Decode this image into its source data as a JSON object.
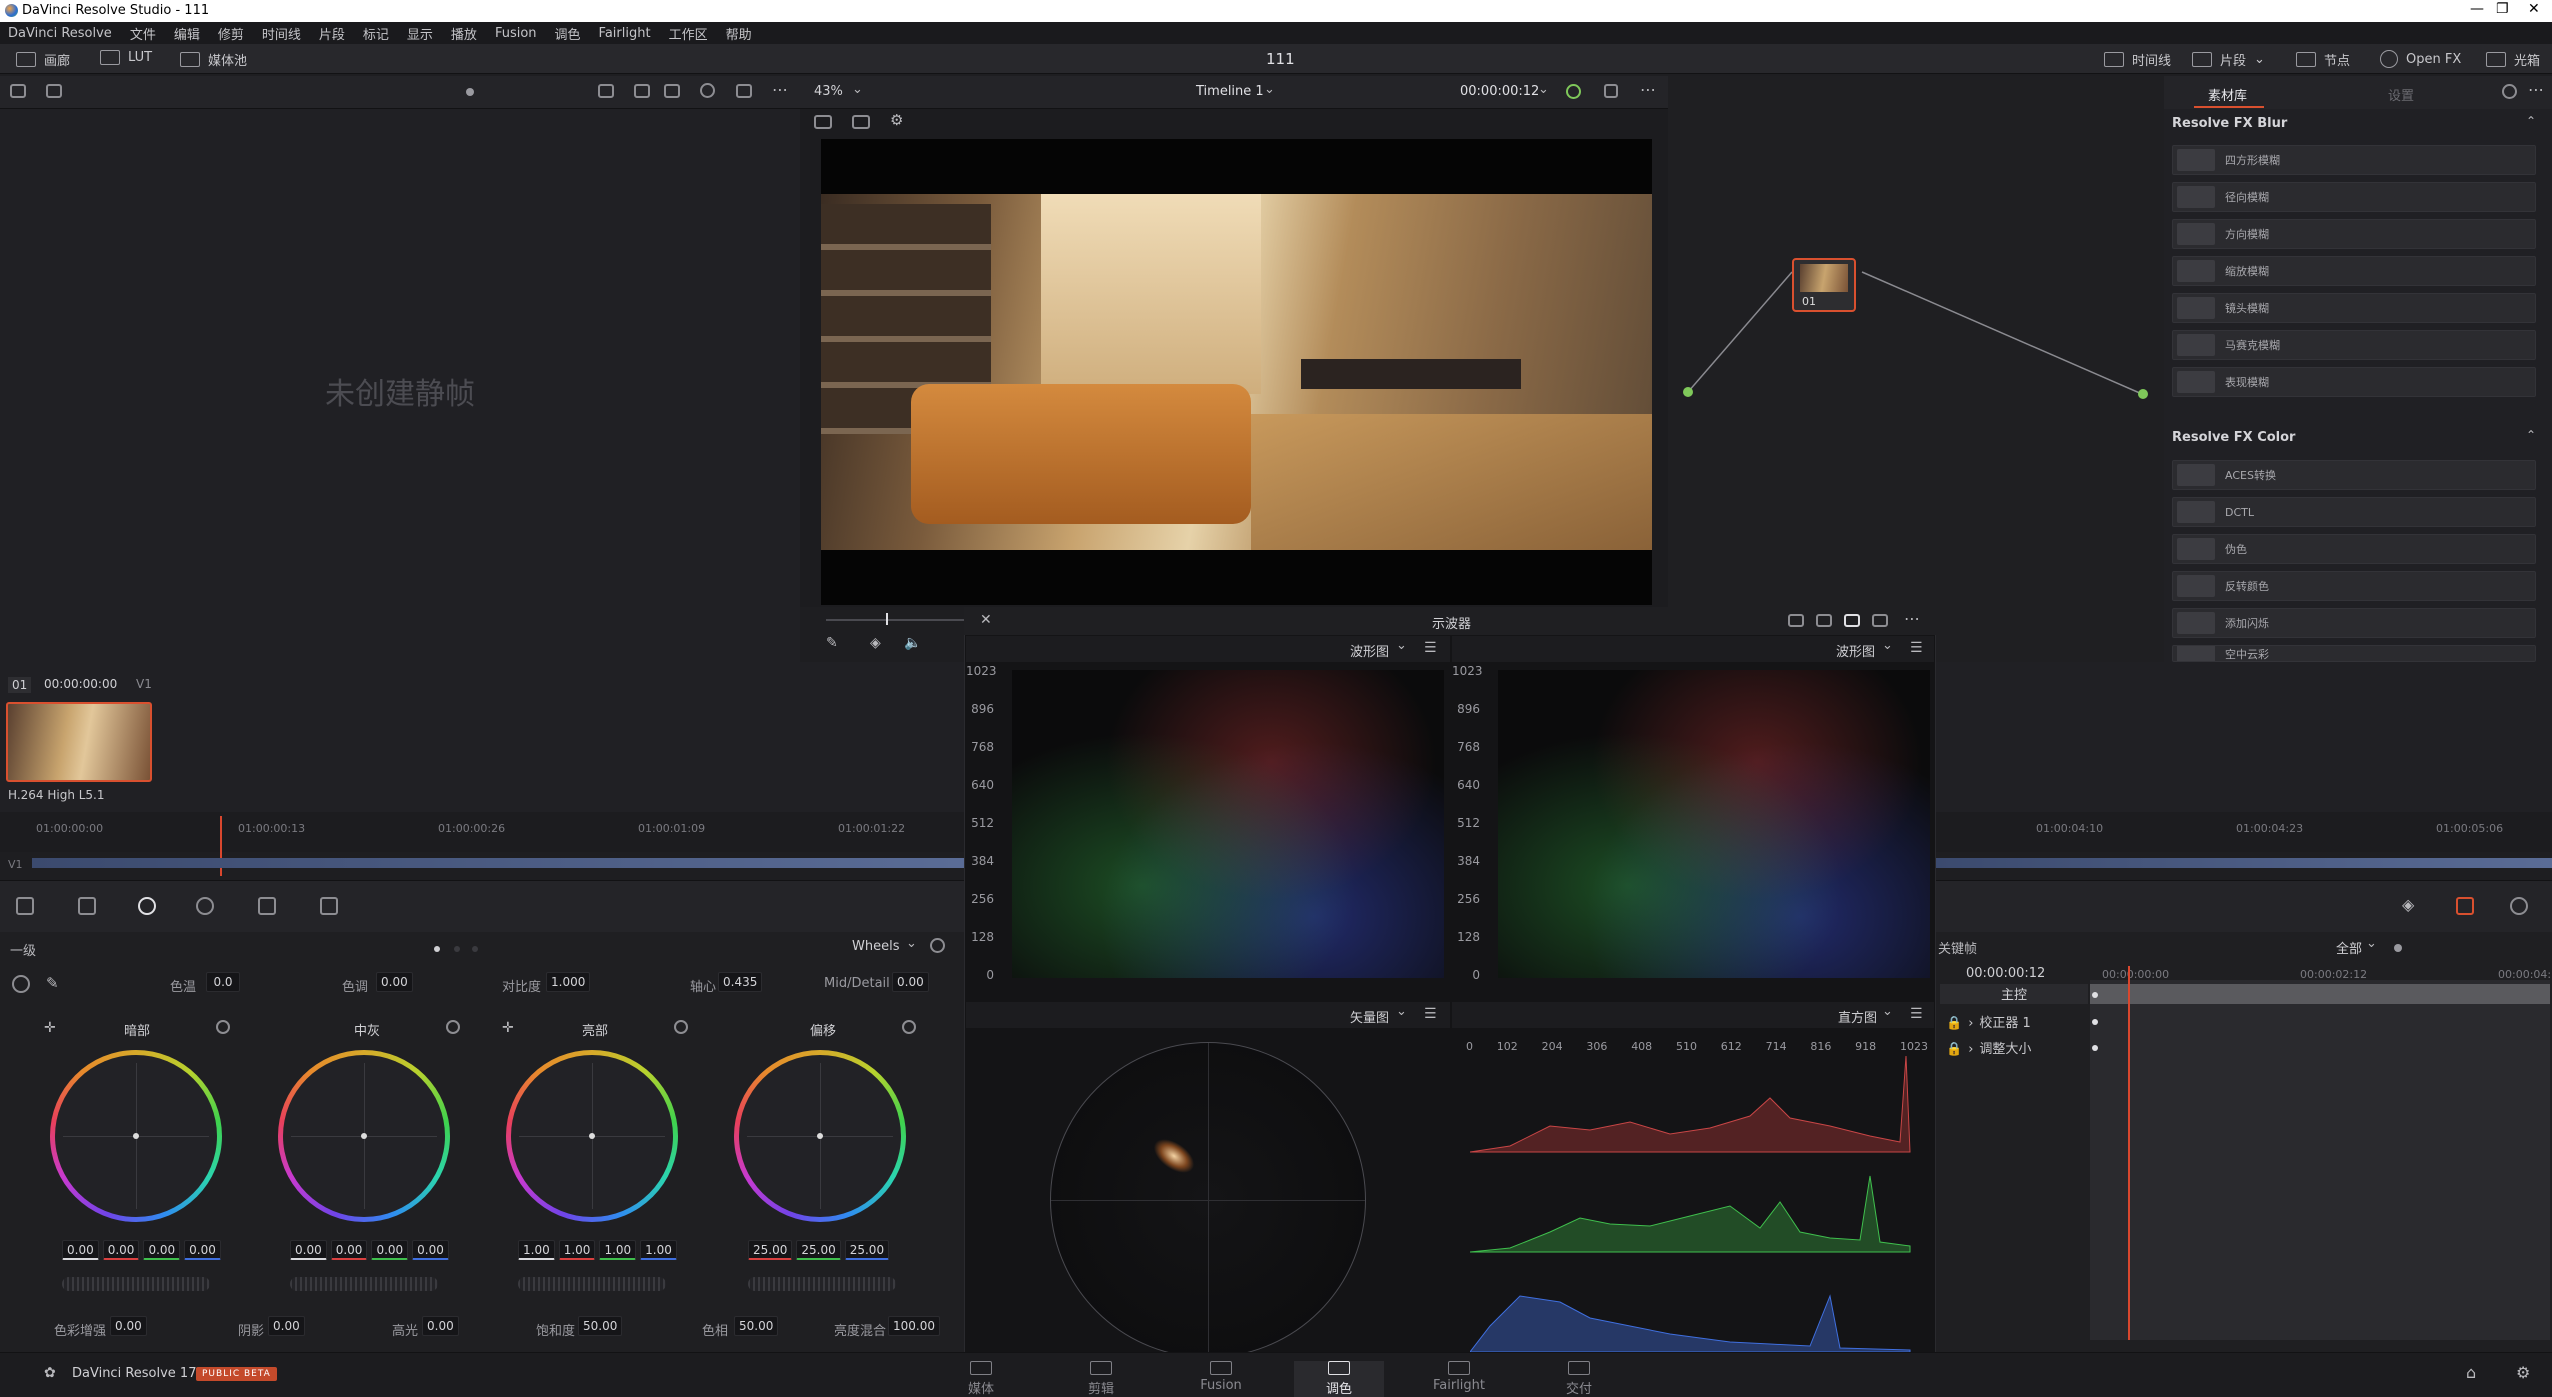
{
  "window": {
    "title": "DaVinci Resolve Studio - 111"
  },
  "menu": [
    "DaVinci Resolve",
    "文件",
    "编辑",
    "修剪",
    "时间线",
    "片段",
    "标记",
    "显示",
    "播放",
    "Fusion",
    "调色",
    "Fairlight",
    "工作区",
    "帮助"
  ],
  "toolbar": {
    "gallery": "画廊",
    "lut": "LUT",
    "media_pool": "媒体池",
    "project_title": "111",
    "timeline": "时间线",
    "clips": "片段",
    "nodes": "节点",
    "openfx": "Open FX",
    "lightbox": "光箱"
  },
  "viewer": {
    "zoom": "43%",
    "timeline_name": "Timeline 1",
    "timecode": "00:00:00:12",
    "clip_mode": "片段"
  },
  "gallery": {
    "empty_text": "未创建静帧"
  },
  "node": {
    "label": "01"
  },
  "library": {
    "tabs": [
      "素材库",
      "设置"
    ],
    "sections": [
      {
        "title": "Resolve FX Blur",
        "items": [
          "四方形模糊",
          "径向模糊",
          "方向模糊",
          "缩放模糊",
          "镜头模糊",
          "马赛克模糊",
          "表现模糊"
        ]
      },
      {
        "title": "Resolve FX Color",
        "items": [
          "ACES转换",
          "DCTL",
          "伪色",
          "反转颜色",
          "添加闪烁",
          "空中云彩"
        ]
      }
    ]
  },
  "clip": {
    "index": "01",
    "timecode": "00:00:00:00",
    "track": "V1",
    "codec": "H.264 High L5.1"
  },
  "ruler": {
    "left_ticks": [
      "01:00:00:00",
      "01:00:00:13",
      "01:00:00:26",
      "01:00:01:09",
      "01:00:01:22"
    ],
    "right_ticks": [
      "01:00:04:10",
      "01:00:04:23",
      "01:00:05:06"
    ],
    "track": "V1"
  },
  "scopes": {
    "title": "示波器",
    "top_left": "波形图",
    "top_right": "波形图",
    "bottom_left": "矢量图",
    "bottom_right": "直方图",
    "wave_labels": [
      "1023",
      "896",
      "768",
      "640",
      "512",
      "384",
      "256",
      "128",
      "0"
    ],
    "hist_labels": [
      "0",
      "102",
      "204",
      "306",
      "408",
      "510",
      "612",
      "714",
      "816",
      "918",
      "1023"
    ]
  },
  "wheels": {
    "mode": "一级",
    "view": "Wheels",
    "params_top": [
      {
        "label": "色温",
        "value": "0.0"
      },
      {
        "label": "色调",
        "value": "0.00"
      },
      {
        "label": "对比度",
        "value": "1.000"
      },
      {
        "label": "轴心",
        "value": "0.435"
      },
      {
        "label": "Mid/Detail",
        "value": "0.00"
      }
    ],
    "items": [
      {
        "name": "暗部",
        "values": [
          "0.00",
          "0.00",
          "0.00",
          "0.00"
        ]
      },
      {
        "name": "中灰",
        "values": [
          "0.00",
          "0.00",
          "0.00",
          "0.00"
        ]
      },
      {
        "name": "亮部",
        "values": [
          "1.00",
          "1.00",
          "1.00",
          "1.00"
        ]
      },
      {
        "name": "偏移",
        "values": [
          "25.00",
          "25.00",
          "25.00"
        ]
      }
    ],
    "params_bottom": [
      {
        "label": "色彩增强",
        "value": "0.00"
      },
      {
        "label": "阴影",
        "value": "0.00"
      },
      {
        "label": "高光",
        "value": "0.00"
      },
      {
        "label": "饱和度",
        "value": "50.00"
      },
      {
        "label": "色相",
        "value": "50.00"
      },
      {
        "label": "亮度混合",
        "value": "100.00"
      }
    ]
  },
  "keyframes": {
    "title": "关键帧",
    "filter": "全部",
    "timecode": "00:00:00:12",
    "ticks": [
      "00:00:00:00",
      "00:00:02:12",
      "00:00:04:"
    ],
    "rows": [
      "主控",
      "校正器 1",
      "调整大小"
    ]
  },
  "bottom": {
    "app": "DaVinci Resolve 17",
    "beta": "PUBLIC BETA",
    "pages": [
      "媒体",
      "剪辑",
      "Fusion",
      "调色",
      "Fairlight",
      "交付"
    ],
    "active_page": "调色"
  },
  "colors": {
    "accent": "#d9502f",
    "playhead": "#d9472e"
  }
}
